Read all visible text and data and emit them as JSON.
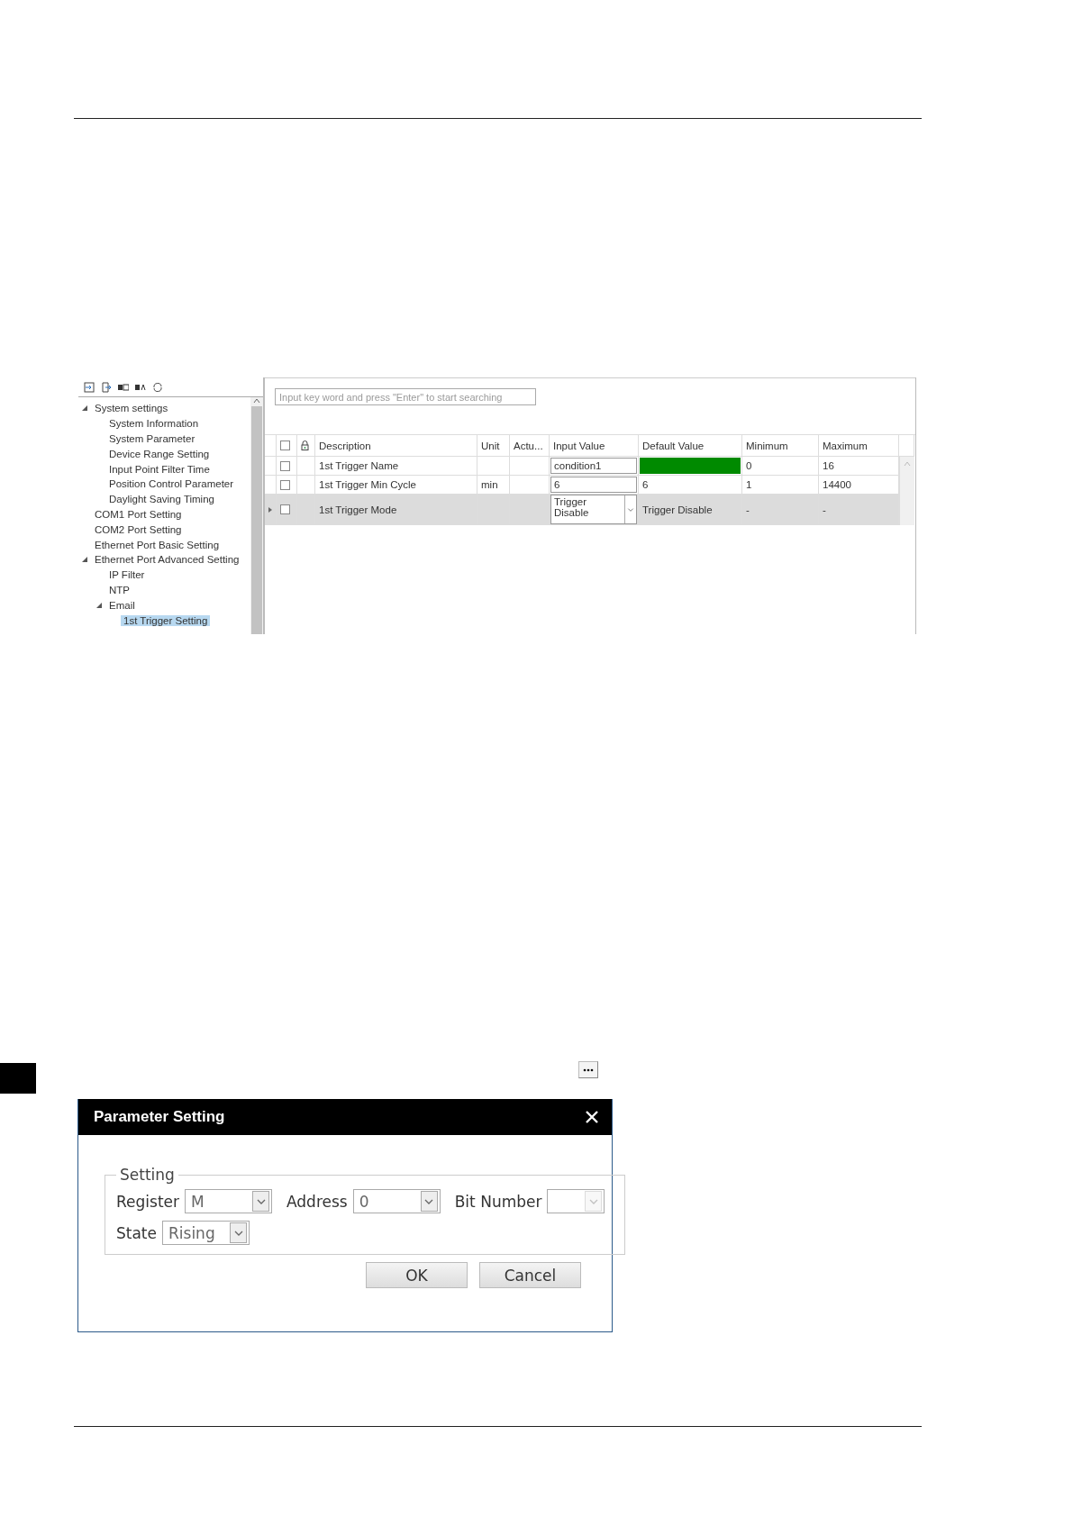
{
  "tree": [
    {
      "label": "System settings",
      "expanded": true,
      "selected": false,
      "children": [
        {
          "label": "System Information",
          "selected": false
        },
        {
          "label": "System Parameter",
          "selected": false
        },
        {
          "label": "Device Range Setting",
          "selected": false
        },
        {
          "label": "Input Point Filter Time",
          "selected": false
        },
        {
          "label": "Position Control Parameter",
          "selected": false
        },
        {
          "label": "Daylight Saving Timing",
          "selected": false
        }
      ]
    },
    {
      "label": "COM1 Port Setting",
      "selected": false
    },
    {
      "label": "COM2 Port Setting",
      "selected": false
    },
    {
      "label": "Ethernet Port Basic Setting",
      "selected": false
    },
    {
      "label": "Ethernet Port Advanced Setting",
      "expanded": true,
      "selected": false,
      "children": [
        {
          "label": "IP Filter",
          "selected": false
        },
        {
          "label": "NTP",
          "selected": false
        },
        {
          "label": "Email",
          "expanded": true,
          "selected": false,
          "children": [
            {
              "label": "1st Trigger Setting",
              "selected": true
            }
          ]
        }
      ]
    }
  ],
  "search": {
    "placeholder": "Input key word and press \"Enter\" to start searching"
  },
  "table": {
    "header_checked": false,
    "columns": [
      "Description",
      "Unit",
      "Actu...",
      "Input Value",
      "Default Value",
      "Minimum",
      "Maximum"
    ],
    "rows": [
      {
        "checked": false,
        "selected": false,
        "description": "1st Trigger Name",
        "kind": "text",
        "input_value": "condition1",
        "color": "#008a00",
        "minimum": "0",
        "maximum": "16"
      },
      {
        "checked": false,
        "selected": false,
        "description": "1st Trigger Min Cycle",
        "unit": "min",
        "kind": "text",
        "input_value": "6",
        "default_value": "6",
        "minimum": "1",
        "maximum": "14400"
      },
      {
        "checked": false,
        "selected": true,
        "description": "1st Trigger Mode",
        "kind": "dropdown",
        "input_value": "Trigger Disable",
        "default_value": "Trigger Disable",
        "minimum": "-",
        "maximum": "-"
      }
    ]
  },
  "dialog": {
    "title": "Parameter Setting",
    "group": "Setting",
    "rows": [
      [
        {
          "label": "Register",
          "value": "M",
          "disabled": false
        },
        {
          "label": "Address",
          "value": "0",
          "disabled": false
        },
        {
          "label": "Bit Number",
          "disabled": true
        }
      ],
      [
        {
          "label": "State",
          "value": "Rising",
          "disabled": false
        }
      ]
    ],
    "buttons": [
      "OK",
      "Cancel"
    ]
  }
}
